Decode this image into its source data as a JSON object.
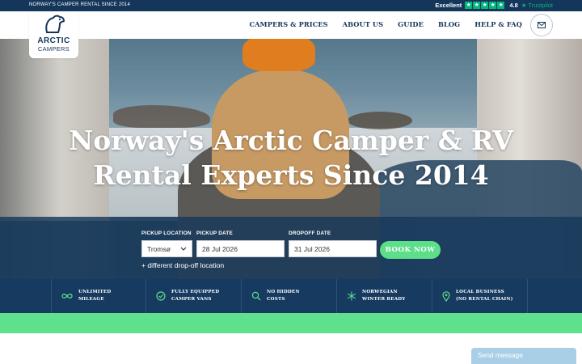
{
  "topbar": {
    "tagline": "NORWAY'S CAMPER RENTAL SINCE 2014",
    "rating_label": "Excellent",
    "rating_score": "4.8",
    "trustpilot": "Trustpilot",
    "star_color": "#00b67a"
  },
  "logo": {
    "line1": "ARCTIC",
    "line2": "CAMPERS"
  },
  "nav": {
    "items": [
      "CAMPERS & PRICES",
      "ABOUT US",
      "GUIDE",
      "BLOG",
      "HELP & FAQ"
    ],
    "mail_icon": "envelope-icon"
  },
  "hero": {
    "headline": "Norway's Arctic Camper & RV Rental Experts Since 2014"
  },
  "booking": {
    "pickup_location_label": "PICKUP LOCATION",
    "pickup_location_value": "Tromsø",
    "pickup_date_label": "PICKUP DATE",
    "pickup_date_value": "28 Jul 2026",
    "dropoff_date_label": "DROPOFF DATE",
    "dropoff_date_value": "31 Jul 2026",
    "book_button": "BOOK NOW",
    "different_dropoff": "+ different drop-off location"
  },
  "features": [
    {
      "icon": "infinity-icon",
      "text": "UNLIMITED\nMILEAGE"
    },
    {
      "icon": "check-circle-icon",
      "text": "FULLY EQUIPPED\nCAMPER VANS"
    },
    {
      "icon": "magnifier-icon",
      "text": "NO HIDDEN\nCOSTS"
    },
    {
      "icon": "snowflake-icon",
      "text": "NORWEGIAN\nWINTER READY"
    },
    {
      "icon": "location-pin-icon",
      "text": "LOCAL BUSINESS\n(NO RENTAL CHAIN)"
    }
  ],
  "chat": {
    "label": "Send message"
  },
  "colors": {
    "navy": "#14365a",
    "green": "#5ee08d",
    "chat": "#a9cfe6"
  }
}
